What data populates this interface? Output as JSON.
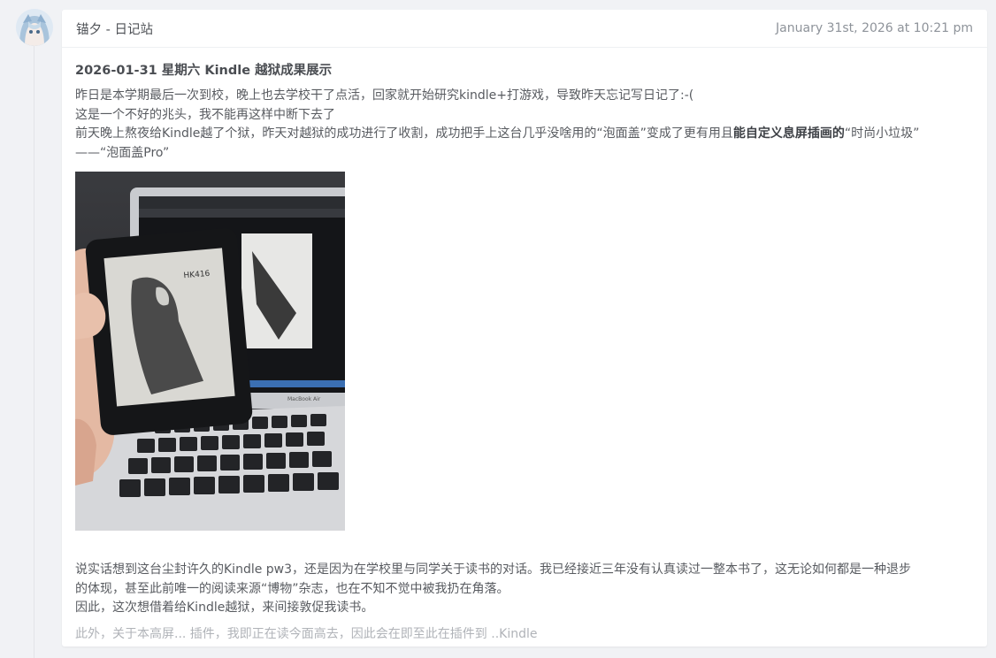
{
  "post": {
    "author": "锚夕 - 日记站",
    "timestamp": "January 31st, 2026 at 10:21 pm",
    "title": "2026-01-31 星期六 Kindle 越狱成果展示",
    "line1": "昨日是本学期最后一次到校，晚上也去学校干了点活，回家就开始研究kindle+打游戏，导致昨天忘记写日记了:-(",
    "line2": "这是一个不好的兆头，我不能再这样中断下去了",
    "line3_pre": "前天晚上熬夜给Kindle越了个狱，昨天对越狱的成功进行了收割，成功把手上这台几乎没啥用的“泡面盖”变成了更有用且",
    "line3_bold": "能自定义息屏插画的",
    "line3_post": "“时尚小垃圾”",
    "line4": "——“泡面盖Pro”",
    "photo_screen_text": "HK416",
    "photo_laptop_label": "MacBook Air",
    "para2_line1": "说实话想到这台尘封许久的Kindle pw3，还是因为在学校里与同学关于读书的对话。我已经接近三年没有认真读过一整本书了，这无论如何都是一种退步",
    "para2_line2": "的体现，甚至此前唯一的阅读来源“博物”杂志，也在不知不觉中被我扔在角落。",
    "para2_line3": "因此，这次想借着给Kindle越狱，来间接敦促我读书。",
    "para3_partial": "此外，关于本高屏... 插件，我即正在读今面高去，因此会在即至此在插件到 ..Kindle"
  }
}
